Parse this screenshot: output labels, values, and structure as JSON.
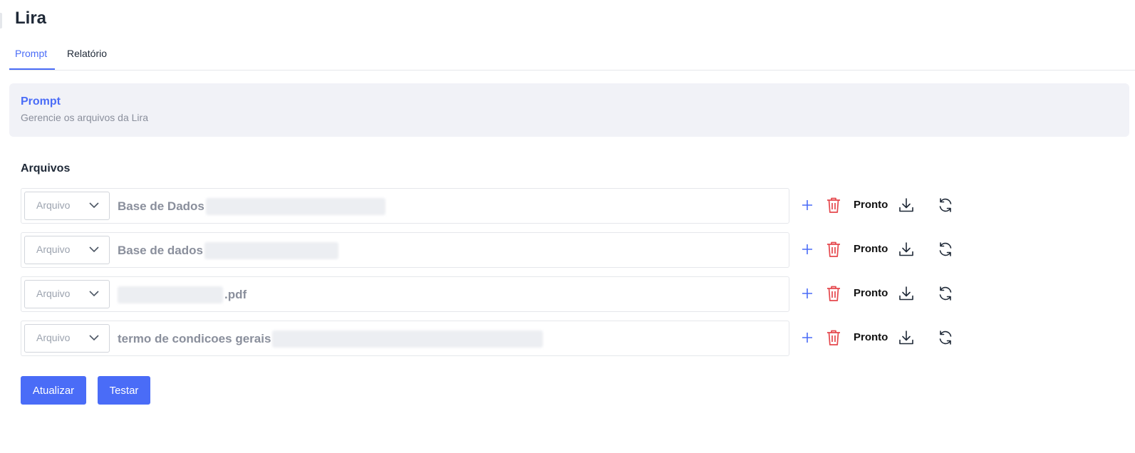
{
  "app": {
    "title": "Lira"
  },
  "tabs": [
    {
      "label": "Prompt",
      "active": true
    },
    {
      "label": "Relatório",
      "active": false
    }
  ],
  "info": {
    "title": "Prompt",
    "subtitle": "Gerencie os arquivos da Lira"
  },
  "files": {
    "section_title": "Arquivos",
    "rows": [
      {
        "type": "Arquivo",
        "name": "Base de Dados",
        "suffix": "",
        "status": "Pronto"
      },
      {
        "type": "Arquivo",
        "name": "Base de dados",
        "suffix": "",
        "status": "Pronto"
      },
      {
        "type": "Arquivo",
        "name": "",
        "suffix": ".pdf",
        "status": "Pronto"
      },
      {
        "type": "Arquivo",
        "name": "termo de condicoes gerais",
        "suffix": "",
        "status": "Pronto"
      }
    ]
  },
  "buttons": {
    "update_label": "Atualizar",
    "test_label": "Testar"
  },
  "colors": {
    "accent": "#4a6cf7",
    "danger": "#e5484d",
    "panel_bg": "#f1f2f7"
  },
  "icons": {
    "add": "plus-icon",
    "delete": "trash-icon",
    "download": "download-icon",
    "refresh": "refresh-icon",
    "dropdown": "chevron-down-icon"
  }
}
